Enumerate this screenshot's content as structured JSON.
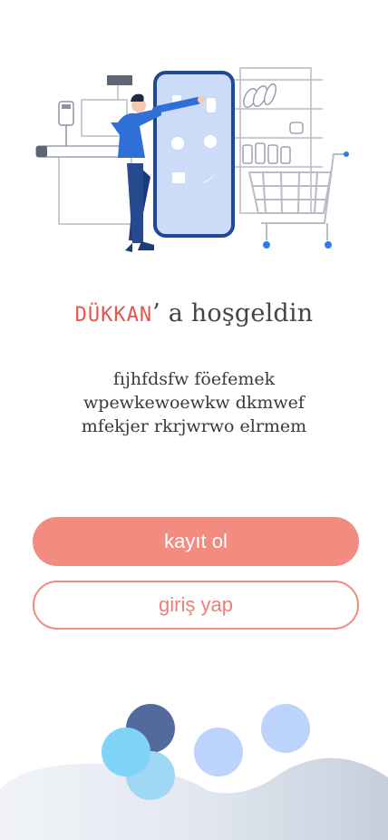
{
  "welcome": {
    "brand": "DÜKKAN",
    "greeting": "’ a hoşgeldin",
    "description": "fıjhfdsfw föefemek wpewkewoewkw dkmwef mfekjer rkrjwrwo elrmem"
  },
  "actions": {
    "register_label": "kayıt ol",
    "login_label": "giriş yap"
  },
  "colors": {
    "brand": "#e8534f",
    "primary_button": "#f28b80",
    "secondary_border": "#f08c82"
  }
}
